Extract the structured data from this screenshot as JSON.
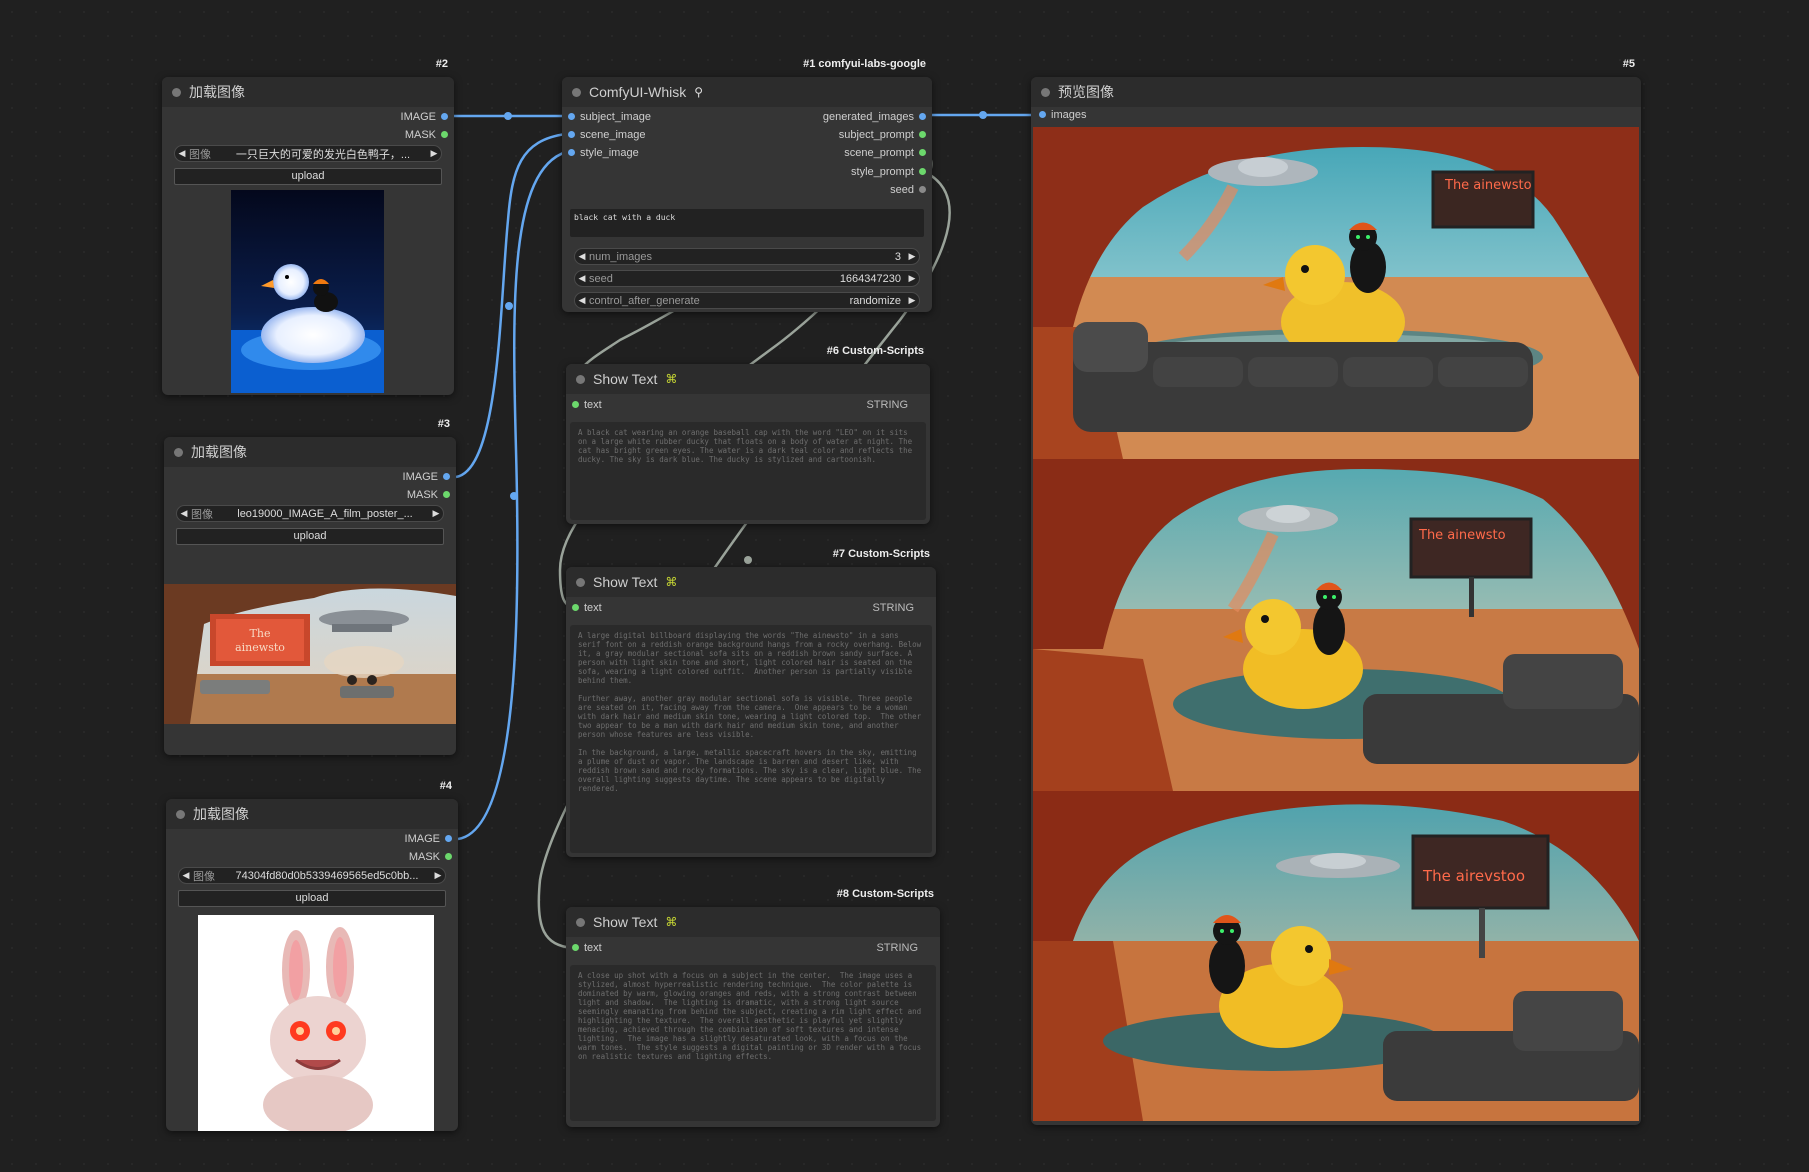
{
  "nodes": {
    "load1": {
      "id": "#2",
      "title": "加载图像",
      "outputs": [
        "IMAGE",
        "MASK"
      ],
      "image_label": "图像",
      "image_value": "一只巨大的可爱的发光白色鸭子，...",
      "upload_label": "upload"
    },
    "load2": {
      "id": "#3",
      "title": "加载图像",
      "outputs": [
        "IMAGE",
        "MASK"
      ],
      "image_label": "图像",
      "image_value": "leo19000_IMAGE_A_film_poster_...",
      "upload_label": "upload",
      "poster_text": "The ainewsto"
    },
    "load3": {
      "id": "#4",
      "title": "加载图像",
      "outputs": [
        "IMAGE",
        "MASK"
      ],
      "image_label": "图像",
      "image_value": "74304fd80d0b5339469565ed5c0bb...",
      "upload_label": "upload"
    },
    "whisk": {
      "id": "#1 comfyui-labs-google",
      "title": "ComfyUI-Whisk",
      "inputs": [
        "subject_image",
        "scene_image",
        "style_image"
      ],
      "outputs": [
        "generated_images",
        "subject_prompt",
        "scene_prompt",
        "style_prompt",
        "seed"
      ],
      "prompt": "black cat with a duck",
      "widgets": [
        {
          "label": "num_images",
          "value": "3"
        },
        {
          "label": "seed",
          "value": "1664347230"
        },
        {
          "label": "control_after_generate",
          "value": "randomize"
        }
      ]
    },
    "show1": {
      "id": "#6 Custom-Scripts",
      "title": "Show Text",
      "input": "text",
      "output": "STRING",
      "text": "A black cat wearing an orange baseball cap with the word \"LEO\" on it sits on a large white rubber ducky that floats on a body of water at night. The cat has bright green eyes. The water is a dark teal color and reflects the ducky. The sky is dark blue. The ducky is stylized and cartoonish."
    },
    "show2": {
      "id": "#7 Custom-Scripts",
      "title": "Show Text",
      "input": "text",
      "output": "STRING",
      "text": "A large digital billboard displaying the words \"The ainewsto\" in a sans serif font on a reddish orange background hangs from a rocky overhang. Below it, a gray modular sectional sofa sits on a reddish brown sandy surface. A person with light skin tone and short, light colored hair is seated on the sofa, wearing a light colored outfit.  Another person is partially visible behind them.\n\nFurther away, another gray modular sectional sofa is visible. Three people are seated on it, facing away from the camera.  One appears to be a woman with dark hair and medium skin tone, wearing a light colored top.  The other two appear to be a man with dark hair and medium skin tone, and another person whose features are less visible.\n\nIn the background, a large, metallic spacecraft hovers in the sky, emitting a plume of dust or vapor. The landscape is barren and desert like, with reddish brown sand and rocky formations. The sky is a clear, light blue. The overall lighting suggests daytime. The scene appears to be digitally rendered."
    },
    "show3": {
      "id": "#8 Custom-Scripts",
      "title": "Show Text",
      "input": "text",
      "output": "STRING",
      "text": "A close up shot with a focus on a subject in the center.  The image uses a stylized, almost hyperrealistic rendering technique.  The color palette is dominated by warm, glowing oranges and reds, with a strong contrast between light and shadow.  The lighting is dramatic, with a strong light source seemingly emanating from behind the subject, creating a rim light effect and highlighting the texture.  The overall aesthetic is playful yet slightly menacing, achieved through the combination of soft textures and intense lighting.  The image has a slightly desaturated look, with a focus on the warm tones.  The style suggests a digital painting or 3D render with a focus on realistic textures and lighting effects."
    },
    "preview": {
      "id": "#5",
      "title": "预览图像",
      "input": "images",
      "billboards": [
        "The ainewsto",
        "The ainewsto",
        "The airevstoo"
      ]
    }
  },
  "colors": {
    "canvas_bg": "#202020",
    "node_bg": "#353535",
    "node_header": "#2c2c2c",
    "image_wire": "#64a7f0",
    "string_wire": "#9aa39a",
    "string_slot": "#6cd86c"
  }
}
